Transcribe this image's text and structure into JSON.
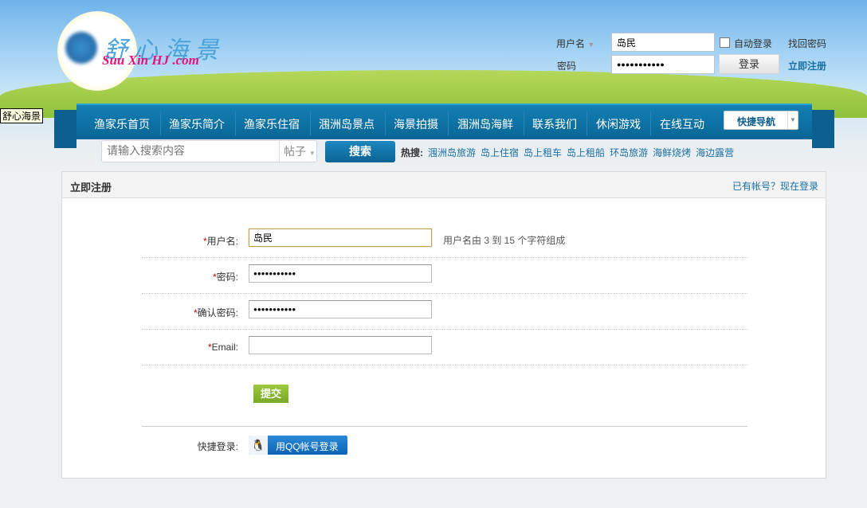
{
  "tooltip": "舒心海景",
  "logo": {
    "cn": "舒心海景",
    "en": "Suu Xin HJ .com"
  },
  "login": {
    "username_label": "用户名",
    "username_value": "岛民",
    "password_label": "密码",
    "password_value": "●●●●●●●●●●●",
    "auto_login": "自动登录",
    "auto_login_checked": false,
    "forgot": "找回密码",
    "login_button": "登录",
    "register": "立即注册"
  },
  "nav": {
    "items": [
      "渔家乐首页",
      "渔家乐简介",
      "渔家乐住宿",
      "涠洲岛景点",
      "海景拍摄",
      "涠洲岛海鲜",
      "联系我们",
      "休闲游戏",
      "在线互动"
    ],
    "quick_nav": "快捷导航"
  },
  "search": {
    "placeholder": "请输入搜索内容",
    "type": "帖子",
    "button": "搜索",
    "hot_label": "热搜:",
    "hot": [
      "涠洲岛旅游",
      "岛上住宿",
      "岛上租车",
      "岛上租船",
      "环岛旅游",
      "海鲜烧烤",
      "海边露营"
    ]
  },
  "register": {
    "title": "立即注册",
    "login_link": "已有帐号？现在登录",
    "fields": [
      {
        "label": "用户名:",
        "value": "岛民",
        "hint": "用户名由 3 到 15 个字符组成"
      },
      {
        "label": "密码:",
        "value": "●●●●●●●●●●●"
      },
      {
        "label": "确认密码:",
        "value": "●●●●●●●●●●●"
      },
      {
        "label": "Email:",
        "value": ""
      }
    ],
    "required_mark": "*",
    "submit": "提交",
    "quick_login_label": "快捷登录:",
    "qq_button": "用QQ帐号登录"
  }
}
